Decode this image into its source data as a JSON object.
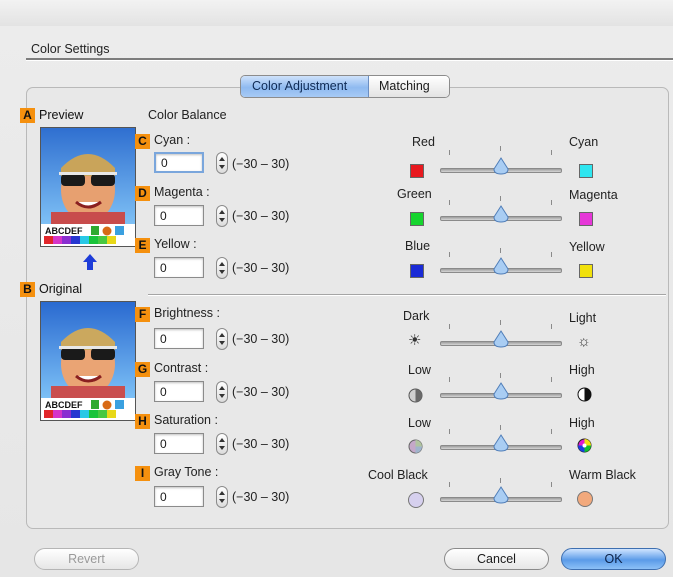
{
  "window": {
    "section_title": "Color Settings"
  },
  "tabs": [
    {
      "label": "Color Adjustment",
      "active": true
    },
    {
      "label": "Matching",
      "active": false
    }
  ],
  "preview": {
    "badge": "A",
    "label": "Preview",
    "palette_text": "ABCDEF"
  },
  "original": {
    "badge": "B",
    "label": "Original",
    "palette_text": "ABCDEF"
  },
  "color_balance": {
    "heading": "Color Balance",
    "fields": [
      {
        "badge": "C",
        "label": "Cyan :",
        "value": "0",
        "range": "(−30 – 30)",
        "left_label": "Red",
        "right_label": "Cyan",
        "left_color": "#e8191f",
        "right_color": "#2fe6f0",
        "level": 0
      },
      {
        "badge": "D",
        "label": "Magenta :",
        "value": "0",
        "range": "(−30 – 30)",
        "left_label": "Green",
        "right_label": "Magenta",
        "left_color": "#16d52e",
        "right_color": "#e637d8",
        "level": 0
      },
      {
        "badge": "E",
        "label": "Yellow :",
        "value": "0",
        "range": "(−30 – 30)",
        "left_label": "Blue",
        "right_label": "Yellow",
        "left_color": "#1a2bd6",
        "right_color": "#f1e10c",
        "level": 0
      }
    ]
  },
  "tone": {
    "fields": [
      {
        "badge": "F",
        "label": "Brightness :",
        "value": "0",
        "range": "(−30 – 30)",
        "left_label": "Dark",
        "right_label": "Light",
        "left_icon": "dark-sun-icon",
        "right_icon": "light-sun-icon",
        "level": 0
      },
      {
        "badge": "G",
        "label": "Contrast :",
        "value": "0",
        "range": "(−30 – 30)",
        "left_label": "Low",
        "right_label": "High",
        "left_icon": "low-contrast-icon",
        "right_icon": "high-contrast-icon",
        "level": 0
      },
      {
        "badge": "H",
        "label": "Saturation :",
        "value": "0",
        "range": "(−30 – 30)",
        "left_label": "Low",
        "right_label": "High",
        "left_icon": "low-saturation-icon",
        "right_icon": "high-saturation-icon",
        "level": 0
      },
      {
        "badge": "I",
        "label": "Gray Tone :",
        "value": "0",
        "range": "(−30 – 30)",
        "left_label": "Cool Black",
        "right_label": "Warm Black",
        "left_color": "#d6d0ee",
        "right_color": "#f2a97c",
        "level": 0
      }
    ]
  },
  "buttons": {
    "revert": "Revert",
    "cancel": "Cancel",
    "ok": "OK"
  }
}
